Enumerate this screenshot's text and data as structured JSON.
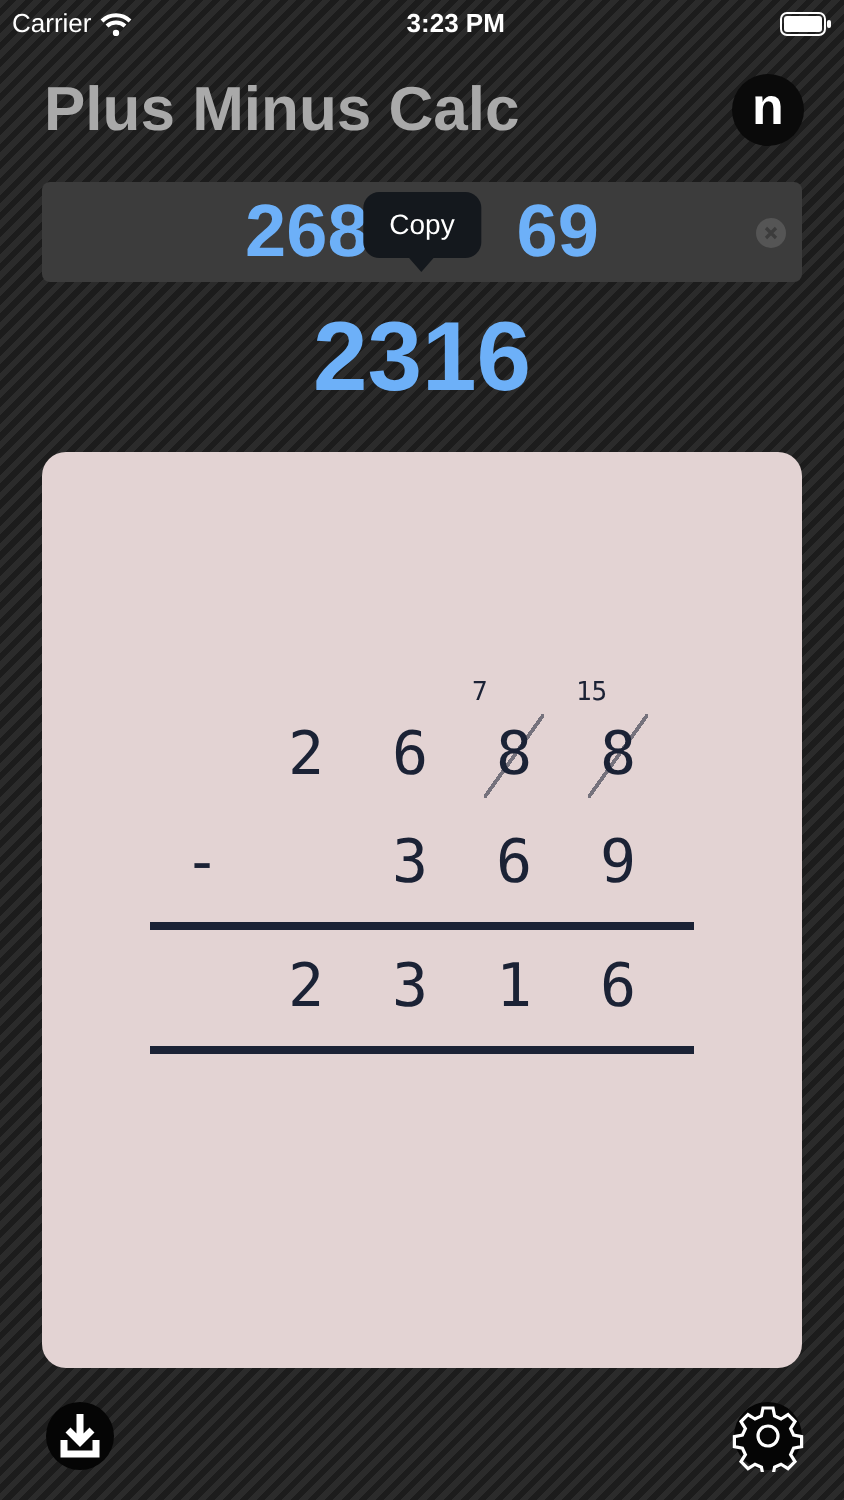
{
  "status_bar": {
    "carrier": "Carrier",
    "time": "3:23 PM"
  },
  "title": "Plus Minus Calc",
  "profile_button": "n",
  "input": {
    "parts": [
      "268",
      "69"
    ]
  },
  "tooltip": "Copy",
  "result": "2316",
  "worksheet": {
    "rows": [
      {
        "rule_below": false,
        "digits": [
          {
            "text": "2",
            "crossed": false
          },
          {
            "text": "6",
            "crossed": false
          },
          {
            "text": "8",
            "crossed": true,
            "carry": "7"
          },
          {
            "text": "8",
            "crossed": true,
            "carry": "15"
          }
        ]
      },
      {
        "operator": "-",
        "rule_below": true,
        "digits": [
          {
            "text": "3",
            "crossed": false
          },
          {
            "text": "6",
            "crossed": false
          },
          {
            "text": "9",
            "crossed": false
          }
        ]
      },
      {
        "rule_below": true,
        "digits": [
          {
            "text": "2",
            "crossed": false
          },
          {
            "text": "3",
            "crossed": false
          },
          {
            "text": "1",
            "crossed": false
          },
          {
            "text": "6",
            "crossed": false
          }
        ]
      }
    ]
  }
}
